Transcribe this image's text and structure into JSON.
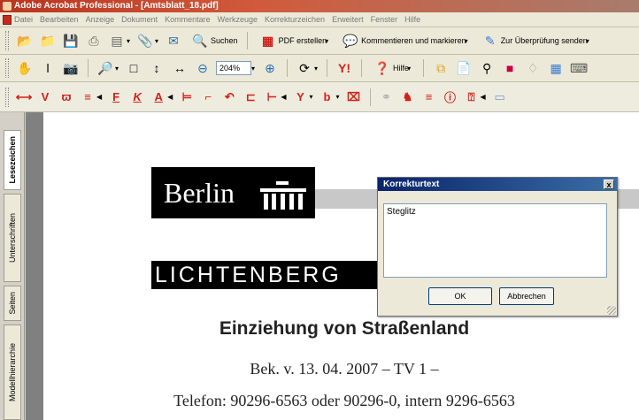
{
  "window": {
    "title": "Adobe Acrobat Professional - [Amtsblatt_18.pdf]"
  },
  "menu": [
    "Datei",
    "Bearbeiten",
    "Anzeige",
    "Dokument",
    "Kommentare",
    "Werkzeuge",
    "Korrekturzeichen",
    "Erweitert",
    "Fenster",
    "Hilfe"
  ],
  "toolbar1": {
    "search_label": "Suchen",
    "create_pdf_label": "PDF erstellen",
    "comment_label": "Kommentieren und markieren",
    "review_label": "Zur Überprüfung senden"
  },
  "toolbar2": {
    "zoom_value": "204%",
    "help_label": "Hilfe"
  },
  "sidebar": {
    "tabs": [
      "Lesezeichen",
      "Unterschriften",
      "Seiten",
      "Modellhierarchie"
    ]
  },
  "document": {
    "berlin_logo_text": "Berlin",
    "district_text": "LICHTENBERG",
    "heading": "Einziehung von Straßenland",
    "bek_line": "Bek. v. 13. 04. 2007 – TV 1 –",
    "telefon_line": "Telefon: 90296-6563 oder 90296-0, intern 9296-6563"
  },
  "dialog": {
    "title": "Korrekturtext",
    "close_label": "x",
    "text_value": "Steglitz",
    "ok_label": "OK",
    "cancel_label": "Abbrechen"
  }
}
